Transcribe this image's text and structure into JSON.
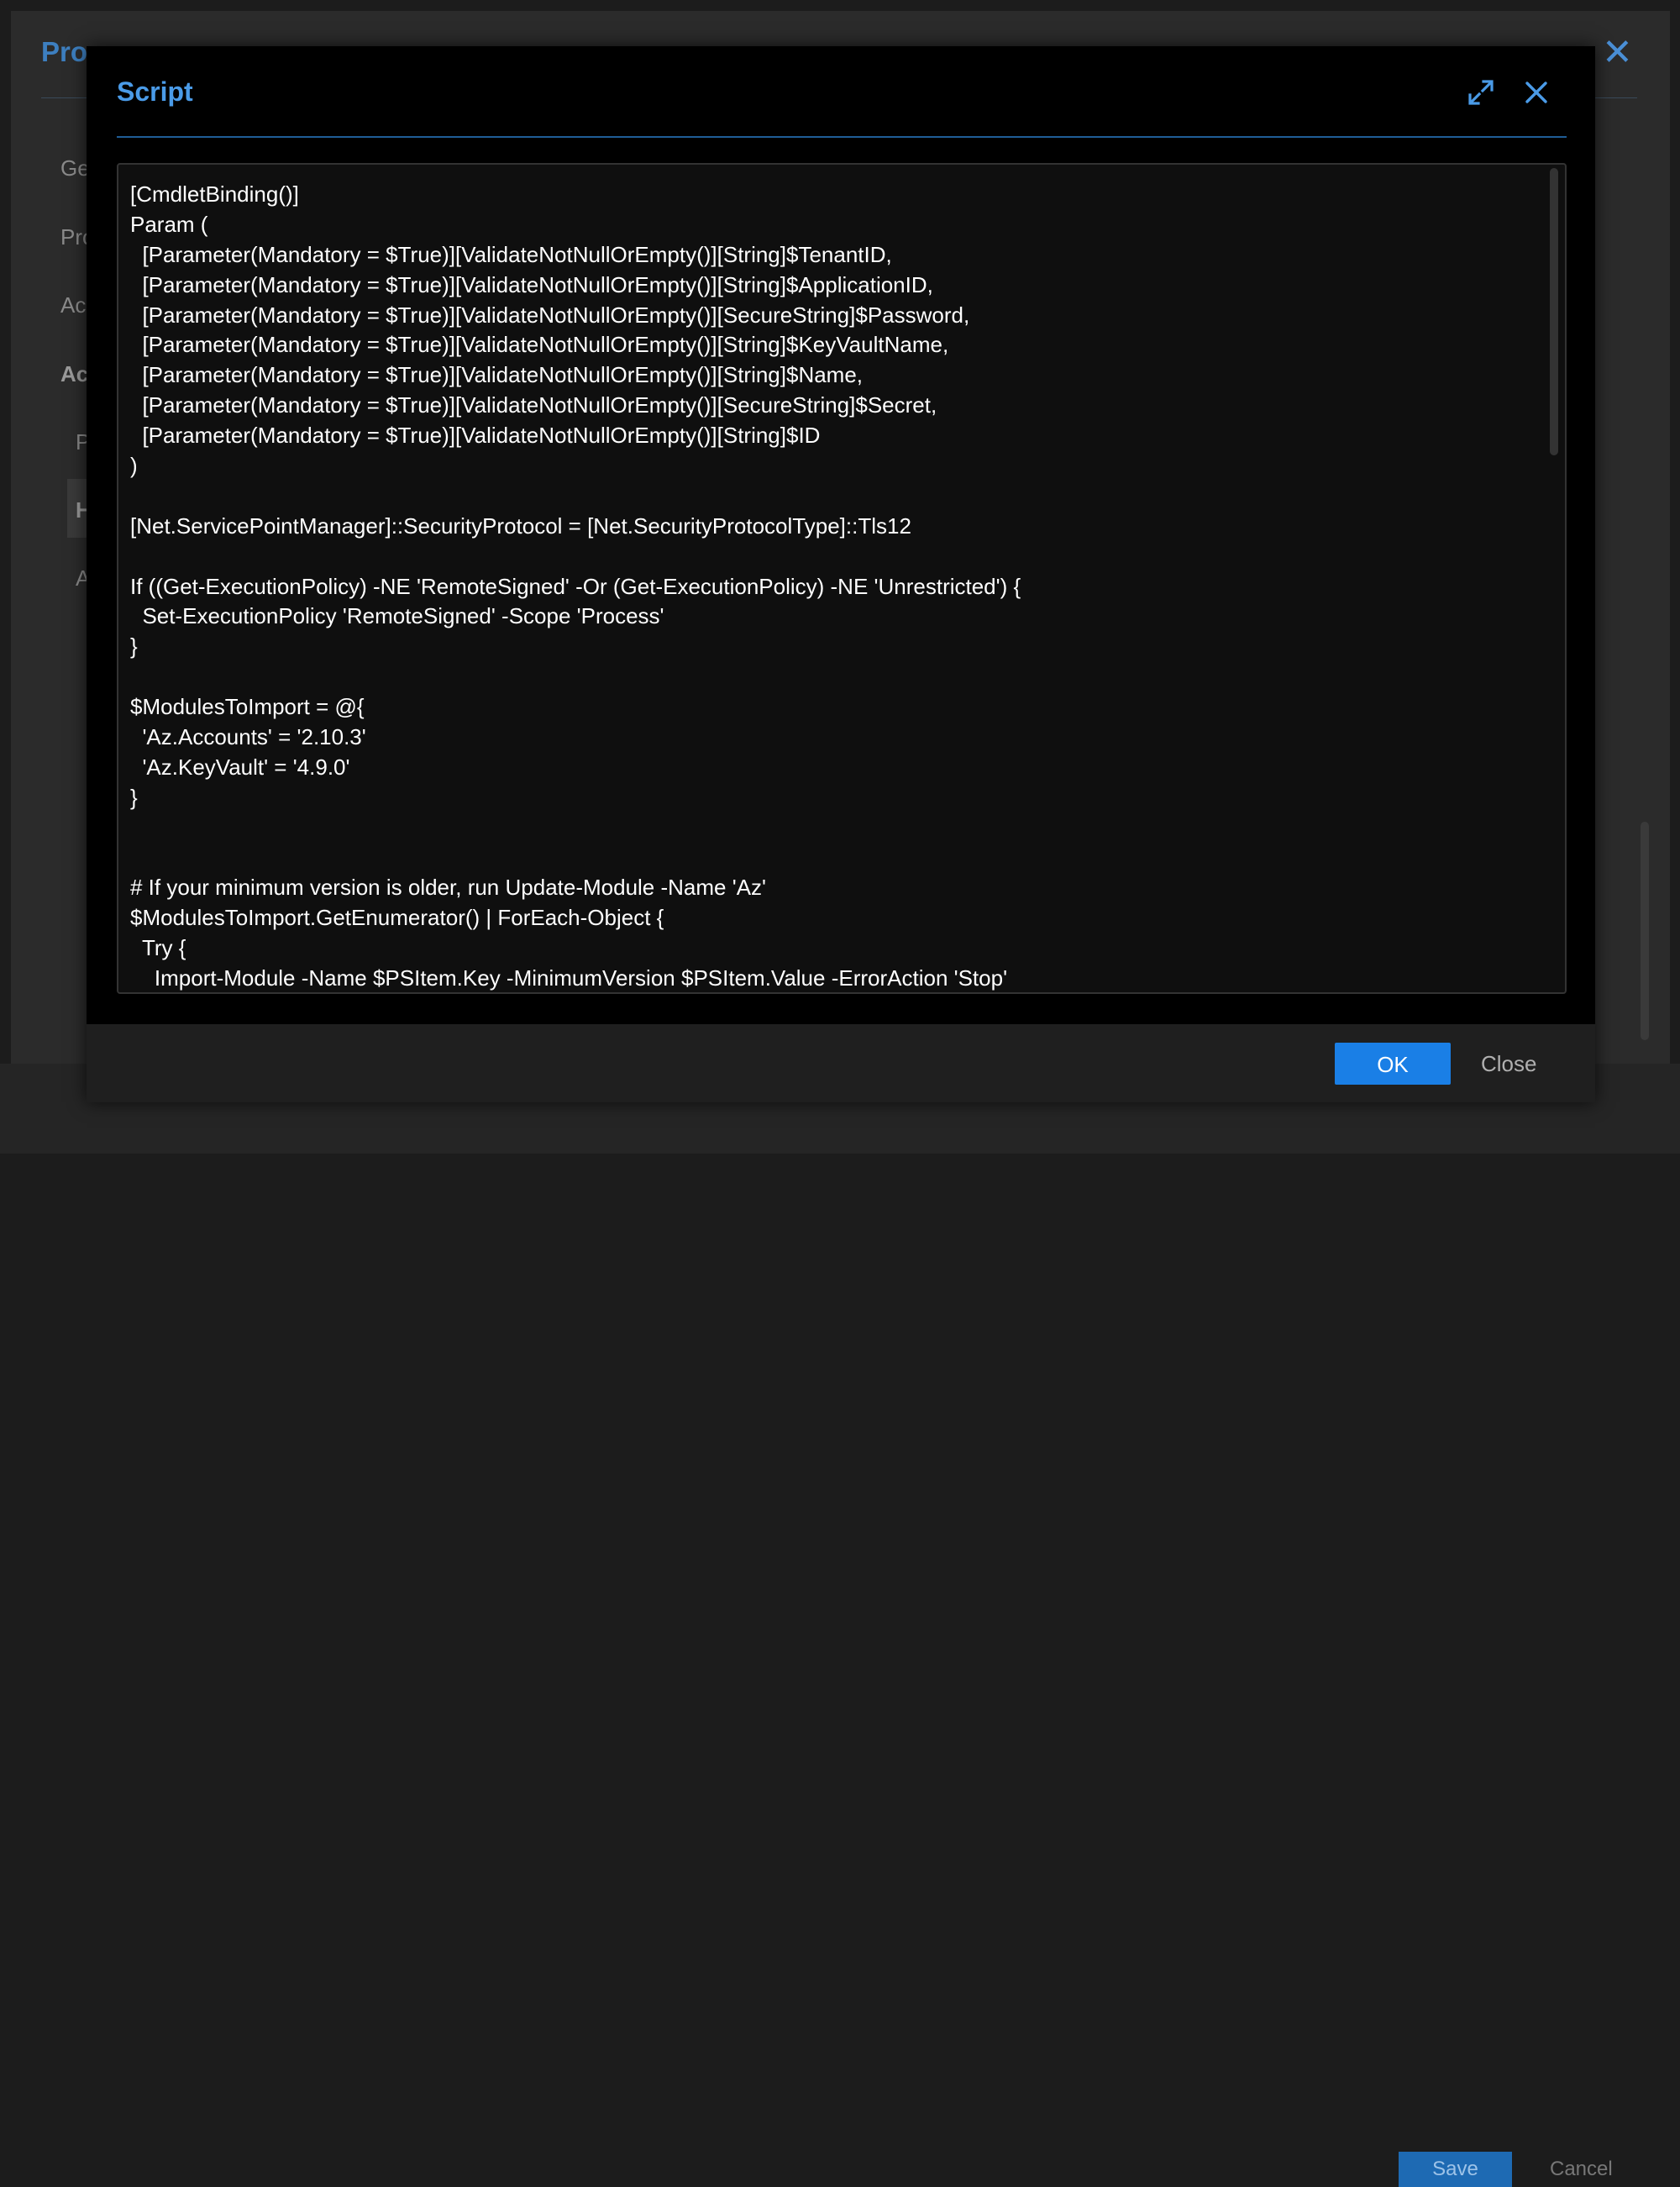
{
  "background_dialog": {
    "title_fragment": "Pro",
    "nav_fragments": [
      "Ge",
      "Pro",
      "Ac",
      "Ac",
      "P",
      "H",
      "A"
    ],
    "save_label": "Save",
    "cancel_label": "Cancel"
  },
  "modal": {
    "title": "Script",
    "expand_icon": "expand-arrows-icon",
    "close_icon": "close-x-icon",
    "code_lines": [
      "[CmdletBinding()]",
      "Param (",
      "  [Parameter(Mandatory = $True)][ValidateNotNullOrEmpty()][String]$TenantID,",
      "  [Parameter(Mandatory = $True)][ValidateNotNullOrEmpty()][String]$ApplicationID,",
      "  [Parameter(Mandatory = $True)][ValidateNotNullOrEmpty()][SecureString]$Password,",
      "  [Parameter(Mandatory = $True)][ValidateNotNullOrEmpty()][String]$KeyVaultName,",
      "  [Parameter(Mandatory = $True)][ValidateNotNullOrEmpty()][String]$Name,",
      "  [Parameter(Mandatory = $True)][ValidateNotNullOrEmpty()][SecureString]$Secret,",
      "  [Parameter(Mandatory = $True)][ValidateNotNullOrEmpty()][String]$ID",
      ")",
      "",
      "[Net.ServicePointManager]::SecurityProtocol = [Net.SecurityProtocolType]::Tls12",
      "",
      "If ((Get-ExecutionPolicy) -NE 'RemoteSigned' -Or (Get-ExecutionPolicy) -NE 'Unrestricted') {",
      "  Set-ExecutionPolicy 'RemoteSigned' -Scope 'Process'",
      "}",
      "",
      "$ModulesToImport = @{",
      "  'Az.Accounts' = '2.10.3'",
      "  'Az.KeyVault' = '4.9.0'",
      "}",
      "",
      "",
      "# If your minimum version is older, run Update-Module -Name 'Az'",
      "$ModulesToImport.GetEnumerator() | ForEach-Object {",
      "  Try {",
      "    Import-Module -Name $PSItem.Key -MinimumVersion $PSItem.Value -ErrorAction 'Stop'"
    ],
    "ok_label": "OK",
    "close_label": "Close"
  },
  "colors": {
    "accent": "#4a9be8",
    "primary_button": "#1a7fe6",
    "modal_bg": "#000000",
    "editor_bg": "#0f0f0f"
  }
}
